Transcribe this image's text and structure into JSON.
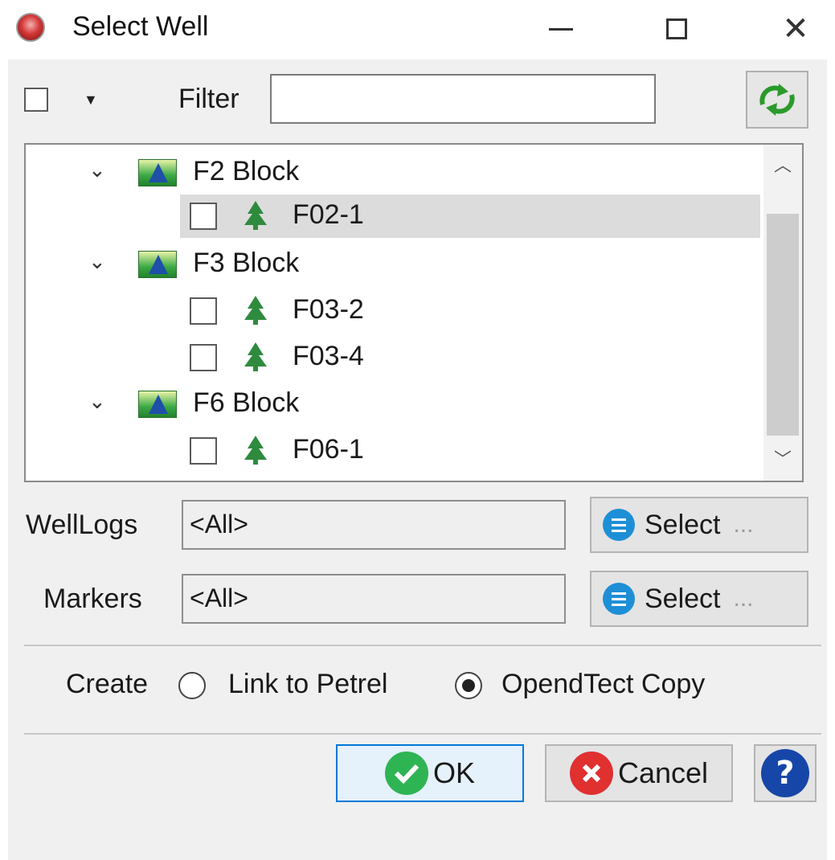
{
  "window": {
    "title": "Select Well",
    "icon": "opendtect-logo-icon",
    "controls": [
      "minimize",
      "maximize",
      "close"
    ]
  },
  "toolbar": {
    "filter_label": "Filter",
    "filter_value": "",
    "select_all_checked": false
  },
  "tree": {
    "groups": [
      {
        "label": "F2 Block",
        "expanded": true,
        "wells": [
          {
            "label": "F02-1",
            "checked": false,
            "selected": true
          }
        ]
      },
      {
        "label": "F3 Block",
        "expanded": true,
        "wells": [
          {
            "label": "F03-2",
            "checked": false
          },
          {
            "label": "F03-4",
            "checked": false
          }
        ]
      },
      {
        "label": "F6 Block",
        "expanded": true,
        "wells": [
          {
            "label": "F06-1",
            "checked": false
          }
        ]
      }
    ]
  },
  "welllogs": {
    "label": "WellLogs",
    "value": "<All>",
    "button": "Select",
    "button_suffix": "..."
  },
  "markers": {
    "label": "Markers",
    "value": "<All>",
    "button": "Select",
    "button_suffix": "..."
  },
  "create": {
    "label": "Create",
    "options": [
      {
        "label": "Link to Petrel",
        "checked": false
      },
      {
        "label": "OpendTect Copy",
        "checked": true
      }
    ]
  },
  "buttons": {
    "ok": "OK",
    "cancel": "Cancel",
    "help": "?"
  },
  "colors": {
    "accent": "#0078d7",
    "ok": "#2fb453",
    "cancel": "#e03030",
    "help": "#1646a8",
    "select": "#1e8fd6"
  }
}
